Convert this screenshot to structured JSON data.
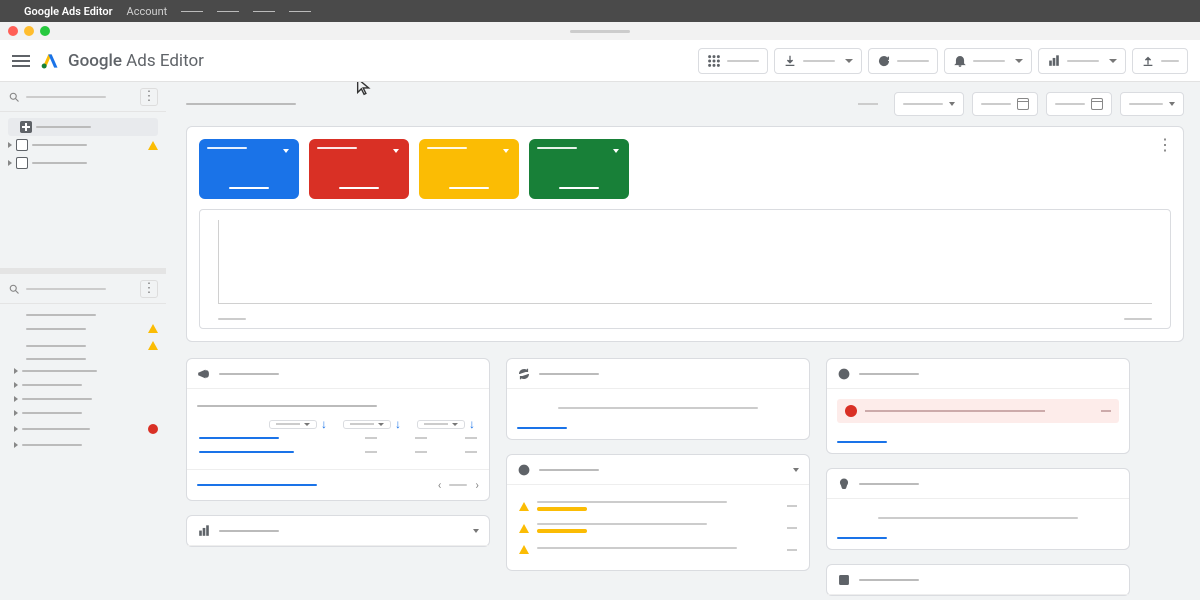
{
  "menubar": {
    "app": "Google Ads Editor",
    "menu1": "Account"
  },
  "window": {},
  "header": {
    "title_bold": "Google",
    "title_rest": " Ads Editor"
  },
  "toolbar_buttons": [
    "grid",
    "download",
    "refresh",
    "notifications",
    "stats",
    "upload"
  ],
  "colors": {
    "blue": "#1a73e8",
    "red": "#d93025",
    "yellow": "#fbbc04",
    "green": "#188038",
    "gray_border": "#dadce0"
  },
  "sidebar": {
    "tree": [
      {
        "icon": "grid",
        "selected": true
      },
      {
        "icon": "cal",
        "warn": true
      },
      {
        "icon": "cal"
      }
    ],
    "nav": [
      {
        "exp": false
      },
      {
        "exp": false,
        "warn": true
      },
      {
        "exp": false,
        "warn": true
      },
      {
        "exp": false
      },
      {
        "exp": true
      },
      {
        "exp": true
      },
      {
        "exp": true
      },
      {
        "exp": true
      },
      {
        "exp": true,
        "err": true
      },
      {
        "exp": true
      }
    ]
  },
  "overview": {
    "scorecards": [
      {
        "color": "blue"
      },
      {
        "color": "red"
      },
      {
        "color": "yellow"
      },
      {
        "color": "green"
      }
    ]
  },
  "chart_data": {
    "type": "line",
    "series": [],
    "xlabel": "",
    "ylabel": "",
    "title": "",
    "x_tick_count": 2
  },
  "cards": {
    "campaigns": {
      "rows": [
        {
          "link": true
        },
        {
          "link": true
        }
      ],
      "sort_cols": 3
    },
    "sync": {},
    "history": {},
    "alerts": {
      "items": [
        {},
        {},
        {},
        {}
      ]
    },
    "recommendations": {},
    "stats": {},
    "notes": {}
  }
}
